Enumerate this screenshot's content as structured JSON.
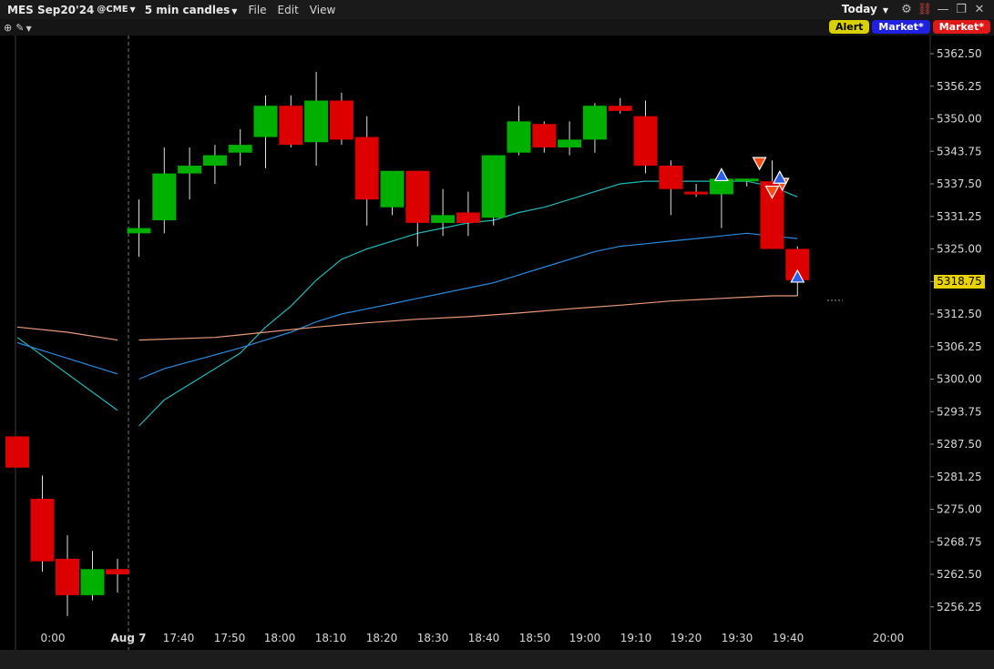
{
  "toolbar": {
    "symbol": "MES Sep20'24",
    "exchange": "@CME",
    "interval": "5 min candles",
    "menu_file": "File",
    "menu_edit": "Edit",
    "menu_view": "View",
    "period": "Today"
  },
  "icons": [
    "gear-icon",
    "link-icon",
    "minimize-icon",
    "restore-icon",
    "close-icon",
    "crosshair-icon",
    "draw-tools-icon"
  ],
  "orders": {
    "alert_label": "Alert",
    "market_buy_label": "Market*",
    "market_sell_label": "Market*"
  },
  "colors": {
    "up": "#00b000",
    "down": "#dd0000",
    "ma_fast": "#20b8b8",
    "ma_mid": "#2a8ae0",
    "ma_slow": "#e89a78",
    "last_price_tag": "#e8d300",
    "alert_btn": "#d9d000",
    "buy_btn": "#2020e0",
    "sell_btn": "#e01818"
  },
  "last_price": "5318.75",
  "chart_data": {
    "type": "candlestick",
    "y_ticks": [
      "5362.50",
      "5356.25",
      "5350.00",
      "5343.75",
      "5337.50",
      "5331.25",
      "5325.00",
      "5318.75",
      "5312.50",
      "5306.25",
      "5300.00",
      "5293.75",
      "5287.50",
      "5281.25",
      "5275.00",
      "5268.75",
      "5262.50",
      "5256.25"
    ],
    "x_ticks": [
      "0:00",
      "Aug 7",
      "17:40",
      "17:50",
      "18:00",
      "18:10",
      "18:20",
      "18:30",
      "18:40",
      "18:50",
      "19:00",
      "19:10",
      "19:20",
      "19:30",
      "19:40",
      "20:00"
    ],
    "ylim": [
      5251,
      5366
    ],
    "candles": [
      {
        "t": 0,
        "o": 5289.0,
        "h": 5289.0,
        "l": 5283.0,
        "c": 5283.0
      },
      {
        "t": 1,
        "o": 5277.0,
        "h": 5281.5,
        "l": 5263.0,
        "c": 5265.0
      },
      {
        "t": 2,
        "o": 5265.5,
        "h": 5270.0,
        "l": 5254.5,
        "c": 5258.5
      },
      {
        "t": 3,
        "o": 5258.5,
        "h": 5267.0,
        "l": 5257.5,
        "c": 5263.5
      },
      {
        "t": 4,
        "o": 5263.5,
        "h": 5265.5,
        "l": 5259.0,
        "c": 5262.5
      },
      {
        "t": 5,
        "o": 5328.0,
        "h": 5334.5,
        "l": 5323.5,
        "c": 5329.0
      },
      {
        "t": 6,
        "o": 5330.5,
        "h": 5344.5,
        "l": 5328.0,
        "c": 5339.5
      },
      {
        "t": 7,
        "o": 5339.5,
        "h": 5344.5,
        "l": 5334.5,
        "c": 5341.0
      },
      {
        "t": 8,
        "o": 5341.0,
        "h": 5345.0,
        "l": 5337.5,
        "c": 5343.0
      },
      {
        "t": 9,
        "o": 5343.5,
        "h": 5348.0,
        "l": 5341.0,
        "c": 5345.0
      },
      {
        "t": 10,
        "o": 5346.5,
        "h": 5354.5,
        "l": 5340.5,
        "c": 5352.5
      },
      {
        "t": 11,
        "o": 5352.5,
        "h": 5354.5,
        "l": 5344.5,
        "c": 5345.0
      },
      {
        "t": 12,
        "o": 5345.5,
        "h": 5359.0,
        "l": 5341.0,
        "c": 5353.5
      },
      {
        "t": 13,
        "o": 5353.5,
        "h": 5355.0,
        "l": 5345.0,
        "c": 5346.0
      },
      {
        "t": 14,
        "o": 5346.5,
        "h": 5350.5,
        "l": 5329.5,
        "c": 5334.5
      },
      {
        "t": 15,
        "o": 5333.0,
        "h": 5339.0,
        "l": 5331.5,
        "c": 5340.0
      },
      {
        "t": 16,
        "o": 5340.0,
        "h": 5340.0,
        "l": 5325.5,
        "c": 5330.0
      },
      {
        "t": 17,
        "o": 5330.0,
        "h": 5336.5,
        "l": 5327.5,
        "c": 5331.5
      },
      {
        "t": 18,
        "o": 5332.0,
        "h": 5336.0,
        "l": 5327.5,
        "c": 5330.0
      },
      {
        "t": 19,
        "o": 5331.0,
        "h": 5338.0,
        "l": 5329.5,
        "c": 5343.0
      },
      {
        "t": 20,
        "o": 5343.5,
        "h": 5352.5,
        "l": 5343.0,
        "c": 5349.5
      },
      {
        "t": 21,
        "o": 5349.0,
        "h": 5349.5,
        "l": 5343.5,
        "c": 5344.5
      },
      {
        "t": 22,
        "o": 5344.5,
        "h": 5349.5,
        "l": 5343.0,
        "c": 5346.0
      },
      {
        "t": 23,
        "o": 5346.0,
        "h": 5353.0,
        "l": 5343.5,
        "c": 5352.5
      },
      {
        "t": 24,
        "o": 5352.5,
        "h": 5354.0,
        "l": 5351.0,
        "c": 5351.5
      },
      {
        "t": 25,
        "o": 5350.5,
        "h": 5353.5,
        "l": 5339.5,
        "c": 5341.0
      },
      {
        "t": 26,
        "o": 5341.0,
        "h": 5342.0,
        "l": 5331.5,
        "c": 5336.5
      },
      {
        "t": 27,
        "o": 5336.0,
        "h": 5337.5,
        "l": 5335.0,
        "c": 5335.5
      },
      {
        "t": 28,
        "o": 5335.5,
        "h": 5339.5,
        "l": 5329.0,
        "c": 5338.5
      },
      {
        "t": 29,
        "o": 5338.5,
        "h": 5338.5,
        "l": 5337.0,
        "c": 5338.5
      },
      {
        "t": 30,
        "o": 5338.0,
        "h": 5342.0,
        "l": 5330.0,
        "c": 5325.0
      },
      {
        "t": 31,
        "o": 5325.0,
        "h": 5325.5,
        "l": 5316.0,
        "c": 5319.0
      }
    ],
    "moving_averages": [
      {
        "name": "fast",
        "points": [
          [
            0,
            5308
          ],
          [
            4,
            5294
          ],
          [
            5,
            5291
          ],
          [
            6,
            5296
          ],
          [
            9,
            5305
          ],
          [
            10,
            5310
          ],
          [
            11,
            5314
          ],
          [
            12,
            5319
          ],
          [
            13,
            5323
          ],
          [
            14,
            5325
          ],
          [
            15,
            5326.5
          ],
          [
            16,
            5328
          ],
          [
            17,
            5329
          ],
          [
            18,
            5330
          ],
          [
            19,
            5330.5
          ],
          [
            20,
            5332
          ],
          [
            21,
            5333
          ],
          [
            22,
            5334.5
          ],
          [
            23,
            5336
          ],
          [
            24,
            5337.5
          ],
          [
            25,
            5338
          ],
          [
            26,
            5338
          ],
          [
            27,
            5338
          ],
          [
            28,
            5338
          ],
          [
            29,
            5338
          ],
          [
            30,
            5337
          ],
          [
            31,
            5335
          ]
        ]
      },
      {
        "name": "mid",
        "points": [
          [
            0,
            5307
          ],
          [
            4,
            5301
          ],
          [
            5,
            5300
          ],
          [
            6,
            5302
          ],
          [
            9,
            5306
          ],
          [
            10,
            5307.5
          ],
          [
            11,
            5309
          ],
          [
            12,
            5311
          ],
          [
            13,
            5312.5
          ],
          [
            14,
            5313.5
          ],
          [
            15,
            5314.5
          ],
          [
            16,
            5315.5
          ],
          [
            17,
            5316.5
          ],
          [
            18,
            5317.5
          ],
          [
            19,
            5318.5
          ],
          [
            20,
            5320
          ],
          [
            21,
            5321.5
          ],
          [
            22,
            5323
          ],
          [
            23,
            5324.5
          ],
          [
            24,
            5325.5
          ],
          [
            25,
            5326
          ],
          [
            26,
            5326.5
          ],
          [
            27,
            5327
          ],
          [
            28,
            5327.5
          ],
          [
            29,
            5328
          ],
          [
            30,
            5327.5
          ],
          [
            31,
            5327
          ]
        ]
      },
      {
        "name": "slow",
        "points": [
          [
            0,
            5310
          ],
          [
            2,
            5309
          ],
          [
            4,
            5307.5
          ],
          [
            5,
            5307.5
          ],
          [
            8,
            5308
          ],
          [
            10,
            5309
          ],
          [
            12,
            5310
          ],
          [
            14,
            5310.8
          ],
          [
            16,
            5311.5
          ],
          [
            18,
            5312
          ],
          [
            20,
            5312.7
          ],
          [
            22,
            5313.5
          ],
          [
            24,
            5314.2
          ],
          [
            26,
            5315
          ],
          [
            28,
            5315.5
          ],
          [
            30,
            5316
          ],
          [
            31,
            5316
          ]
        ]
      }
    ],
    "markers": [
      {
        "t": 28,
        "price": 5339.0,
        "dir": "up",
        "color": "#2a5ee8"
      },
      {
        "t": 29.5,
        "price": 5341.5,
        "dir": "down",
        "color": "#ff4a10"
      },
      {
        "t": 30,
        "price": 5336.0,
        "dir": "down",
        "color": "#ff4a10"
      },
      {
        "t": 30.4,
        "price": 5337.5,
        "dir": "down",
        "color": "#ff4a10"
      },
      {
        "t": 30.3,
        "price": 5338.5,
        "dir": "up",
        "color": "#2a5ee8"
      },
      {
        "t": 31,
        "price": 5319.5,
        "dir": "up",
        "color": "#2a5ee8"
      }
    ]
  }
}
